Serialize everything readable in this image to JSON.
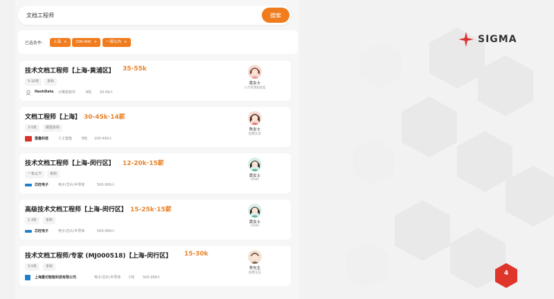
{
  "search": {
    "value": "文档工程师",
    "button_label": "搜索"
  },
  "filters": {
    "label": "已选条件:",
    "chips": [
      "上海",
      "20K-40K",
      "一周以内"
    ],
    "chip_close": "×"
  },
  "jobs": [
    {
      "title": "技术文档工程师【上海-黄浦区】",
      "salary": "35-55k",
      "tags": [
        "5-10年",
        "本科"
      ],
      "company": "HashData",
      "meta": [
        "计算机软件",
        "B轮",
        "50-99人"
      ],
      "recruiter": "黄女士",
      "recruiter_role": "人力资源副总监",
      "logo_color": "#ffffff"
    },
    {
      "title": "文档工程师【上海】",
      "salary": "30-45k·14薪",
      "tags": [
        "3-5年",
        "统招本科"
      ],
      "company": "壹鑫科技",
      "meta": [
        "人工智能",
        "B轮",
        "100-499人"
      ],
      "recruiter": "陈女士",
      "recruiter_role": "招聘负责",
      "logo_color": "#d9342b"
    },
    {
      "title": "技术文档工程师【上海-闵行区】",
      "salary": "12-20k·15薪",
      "tags": [
        "一年以下",
        "本科"
      ],
      "company": "芯旺电子",
      "meta": [
        "电子/芯片/半导体",
        "500-999人"
      ],
      "recruiter": "黄女士",
      "recruiter_role": "HRBP",
      "logo_color": "#1e7fc9"
    },
    {
      "title": "高级技术文档工程师【上海-闵行区】",
      "salary": "15-25k·15薪",
      "tags": [
        "1-3年",
        "本科"
      ],
      "company": "芯旺电子",
      "meta": [
        "电子/芯片/半导体",
        "500-999人"
      ],
      "recruiter": "黄女士",
      "recruiter_role": "HRBP",
      "logo_color": "#1e7fc9"
    },
    {
      "title": "技术文档工程师/专家 (MJ000518)【上海-闵行区】",
      "salary": "15-30k",
      "tags": [
        "3-5年",
        "本科"
      ],
      "company": "上海曼切智能科技有限公司",
      "meta": [
        "电子/芯片/半导体",
        "C轮",
        "500-999人"
      ],
      "recruiter": "李先生",
      "recruiter_role": "招聘主任",
      "logo_color": "#1e7fc9"
    }
  ],
  "brand": {
    "name": "SIGMA",
    "accent": "#d9342b"
  },
  "page_number": "4",
  "colors": {
    "accent_orange": "#f07c1e",
    "salary_orange": "#e8832a"
  }
}
